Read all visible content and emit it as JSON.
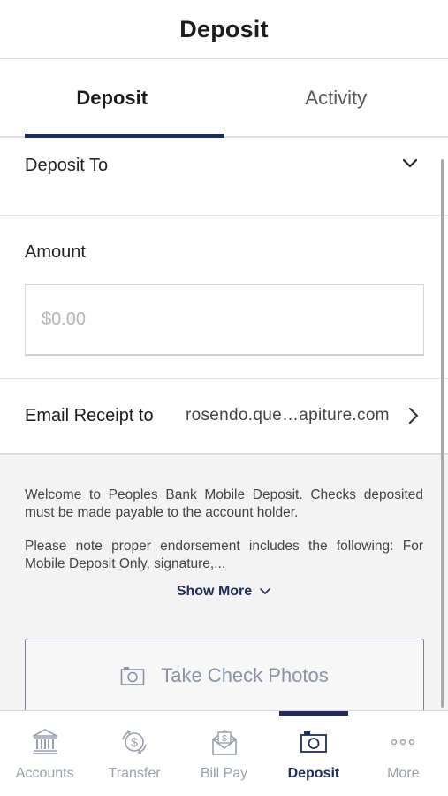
{
  "header": {
    "title": "Deposit"
  },
  "tabs": [
    {
      "label": "Deposit",
      "active": true
    },
    {
      "label": "Activity",
      "active": false
    }
  ],
  "deposit_to": {
    "label": "Deposit To",
    "icon": "chevron-down-icon"
  },
  "amount": {
    "label": "Amount",
    "placeholder": "$0.00",
    "value": ""
  },
  "email_receipt": {
    "label": "Email Receipt to",
    "value": "rosendo.que…apiture.com",
    "icon": "chevron-right-icon"
  },
  "info": {
    "paragraph1": "Welcome to Peoples Bank Mobile Deposit. Checks deposited must be made payable to the account holder.",
    "paragraph2": "Please note proper endorsement includes the following: For Mobile Deposit Only, signature,...",
    "show_more_label": "Show More"
  },
  "take_photos": {
    "label": "Take Check Photos",
    "icon": "camera-icon"
  },
  "bottom_nav": [
    {
      "label": "Accounts",
      "icon": "bank-icon",
      "active": false
    },
    {
      "label": "Transfer",
      "icon": "transfer-icon",
      "active": false
    },
    {
      "label": "Bill Pay",
      "icon": "bill-pay-icon",
      "active": false
    },
    {
      "label": "Deposit",
      "icon": "camera-icon",
      "active": true
    },
    {
      "label": "More",
      "icon": "more-icon",
      "active": false
    }
  ],
  "colors": {
    "accent": "#1f2d5c",
    "muted": "#9aa0b0",
    "info_bg": "#f3f3f3"
  }
}
